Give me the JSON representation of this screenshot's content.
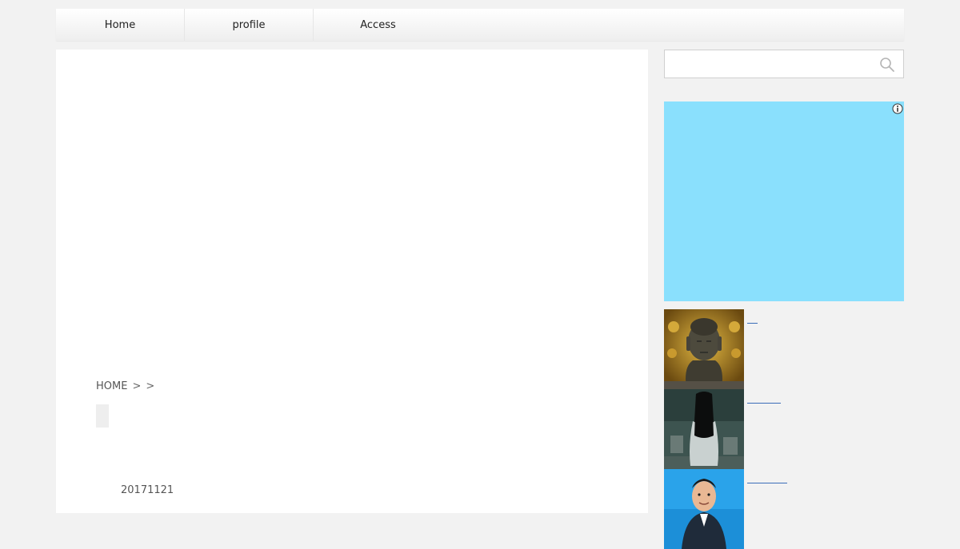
{
  "nav": {
    "items": [
      {
        "label": "Home"
      },
      {
        "label": "profile"
      },
      {
        "label": "Access"
      }
    ]
  },
  "breadcrumb": {
    "home": "HOME",
    "sep1": ">",
    "sep2": ">"
  },
  "post": {
    "date": "20171121"
  },
  "search": {
    "placeholder": ""
  },
  "colors": {
    "ad_background": "#8ae0fd",
    "link": "#3b6db8"
  },
  "icons": {
    "search": "magnifier-icon",
    "ad_info": "info-icon"
  },
  "related": {
    "items": [
      {
        "thumb": "buddha-statue-image"
      },
      {
        "thumb": "long-haired-ghost-image"
      },
      {
        "thumb": "man-in-suit-image"
      }
    ]
  }
}
